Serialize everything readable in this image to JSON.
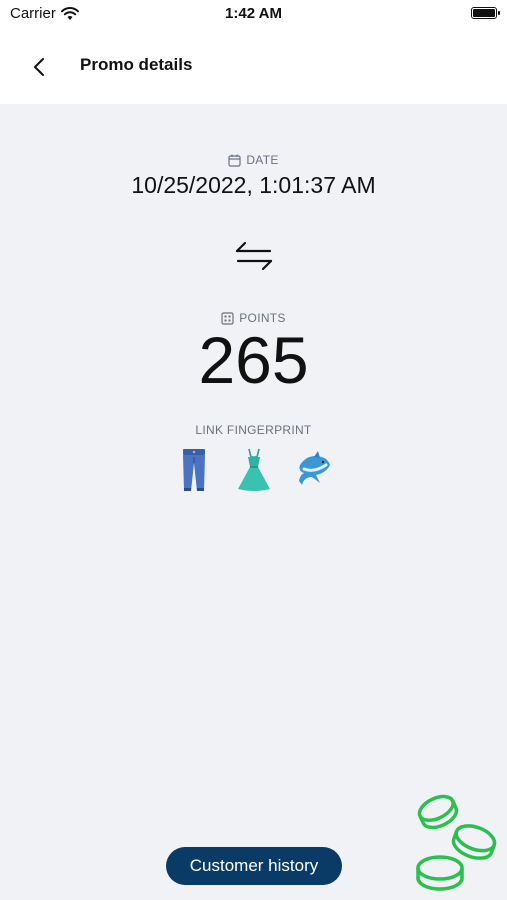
{
  "status_bar": {
    "carrier": "Carrier",
    "time": "1:42 AM"
  },
  "nav": {
    "title": "Promo details"
  },
  "date": {
    "label": "DATE",
    "value": "10/25/2022, 1:01:37 AM"
  },
  "points": {
    "label": "POINTS",
    "value": "265"
  },
  "fingerprint": {
    "label": "LINK FINGERPRINT",
    "emojis": [
      "jeans",
      "dress",
      "dolphin"
    ]
  },
  "actions": {
    "history_label": "Customer history"
  },
  "colors": {
    "accent": "#0a3b66",
    "background": "#f0f2f6",
    "coin": "#2bbf4e"
  }
}
